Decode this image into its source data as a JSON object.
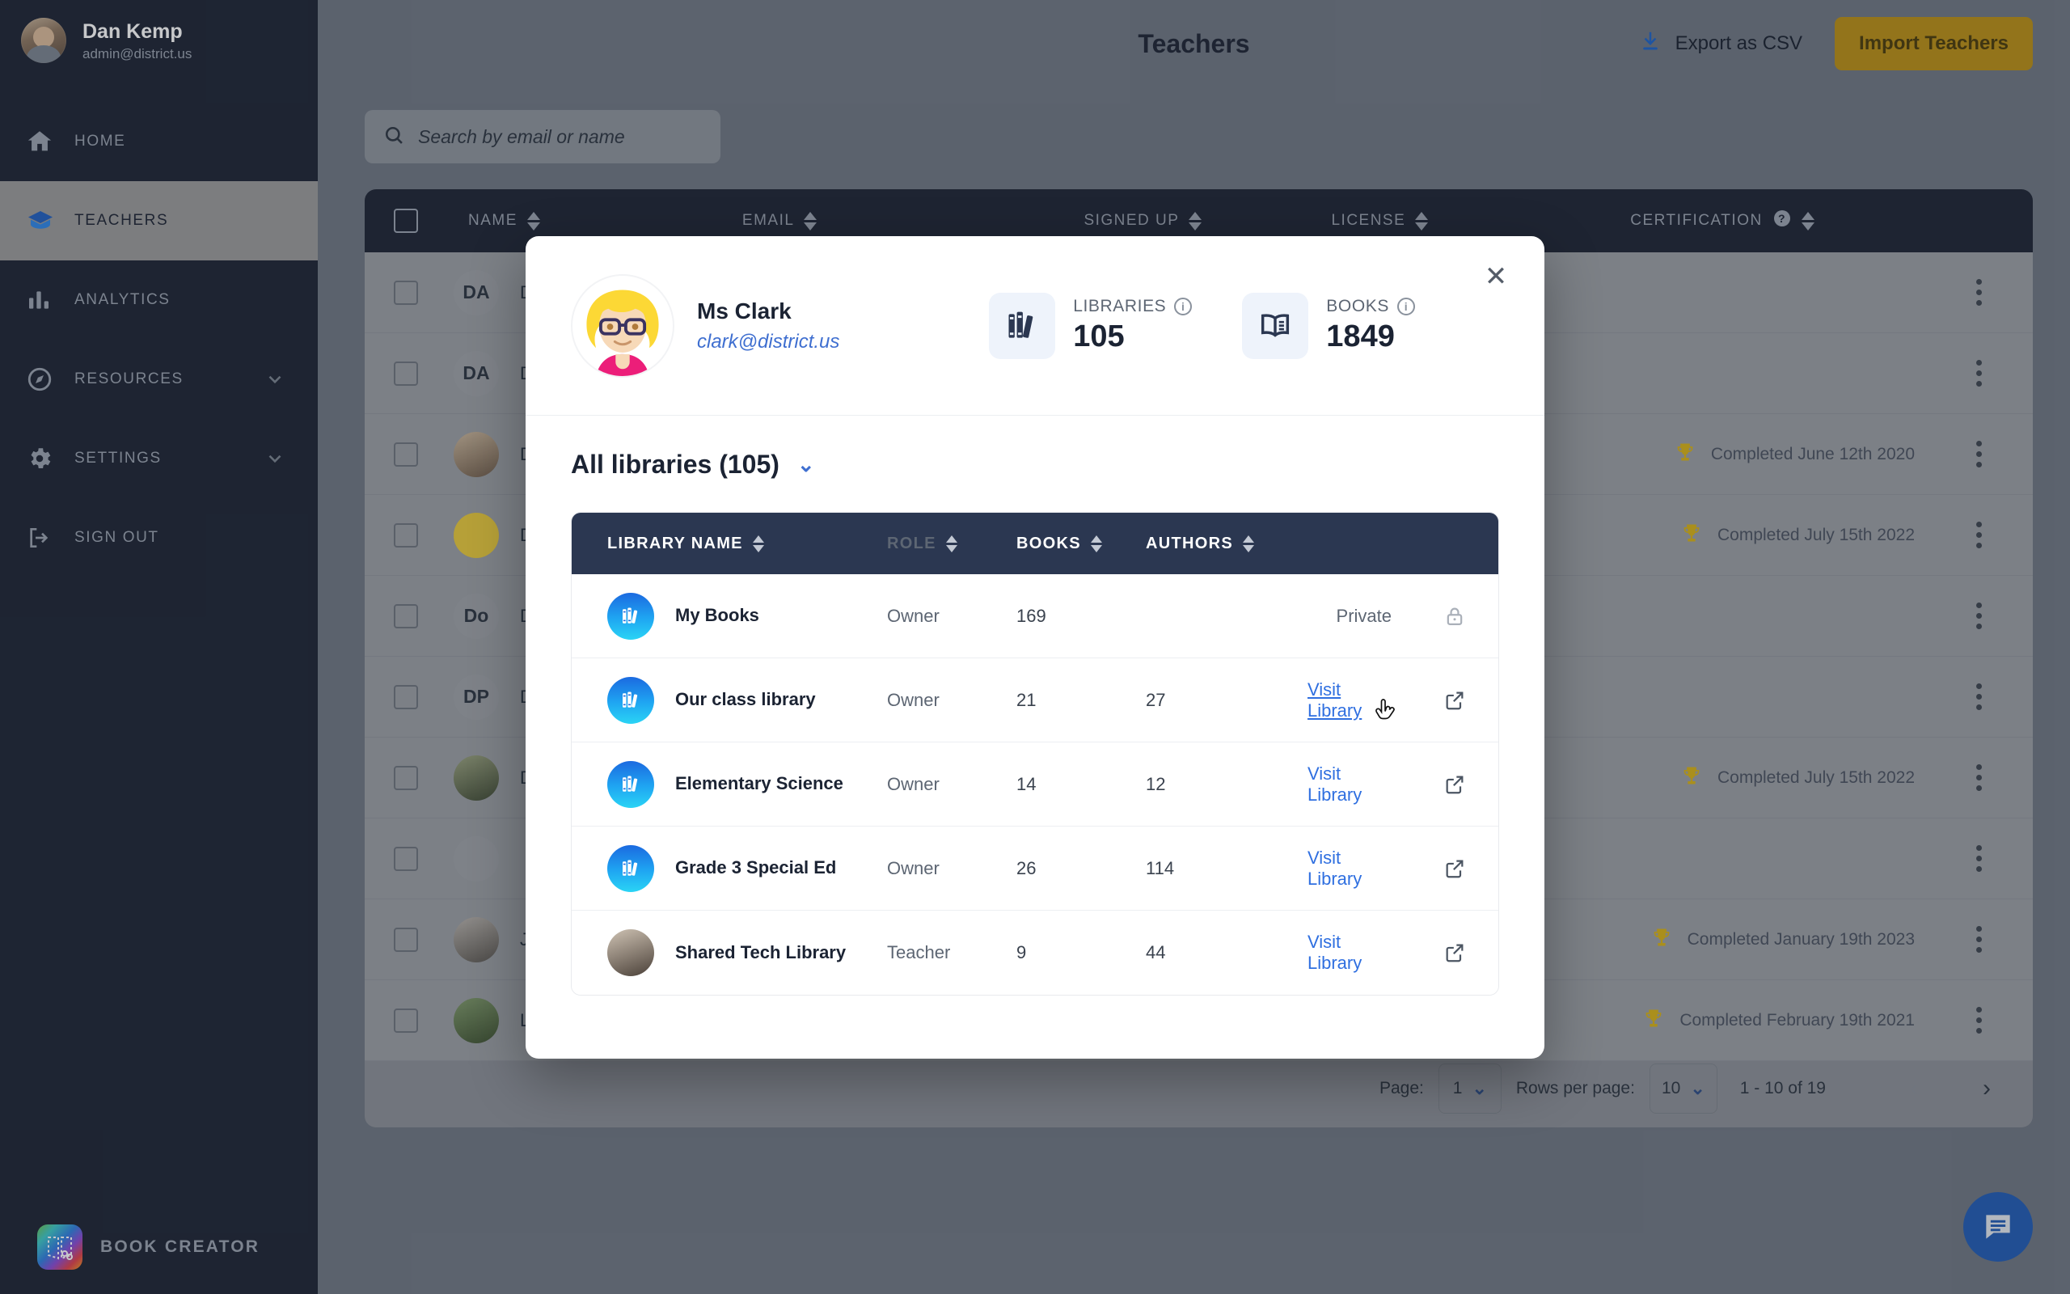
{
  "sidebar": {
    "user": {
      "name": "Dan Kemp",
      "email": "admin@district.us",
      "avatar_icon": "user-photo"
    },
    "items": [
      {
        "label": "HOME",
        "icon": "home-icon",
        "active": false,
        "expandable": false
      },
      {
        "label": "TEACHERS",
        "icon": "graduation-cap-icon",
        "active": true,
        "expandable": false
      },
      {
        "label": "ANALYTICS",
        "icon": "bar-chart-icon",
        "active": false,
        "expandable": false
      },
      {
        "label": "RESOURCES",
        "icon": "compass-icon",
        "active": false,
        "expandable": true
      },
      {
        "label": "SETTINGS",
        "icon": "gear-icon",
        "active": false,
        "expandable": true
      },
      {
        "label": "SIGN OUT",
        "icon": "sign-out-icon",
        "active": false,
        "expandable": false
      }
    ],
    "brand": {
      "label": "BOOK CREATOR",
      "icon": "book-creator-logo"
    }
  },
  "header": {
    "title": "Teachers",
    "export_label": "Export as CSV",
    "export_icon": "download-icon",
    "import_label": "Import Teachers",
    "import_color": "#b98e14"
  },
  "search": {
    "placeholder": "Search by email or name",
    "value": "",
    "icon": "search-icon"
  },
  "teachers_table": {
    "columns": [
      "NAME",
      "EMAIL",
      "SIGNED UP",
      "LICENSE",
      "CERTIFICATION"
    ],
    "certification_help_icon": "question-mark-icon",
    "rows": [
      {
        "initials": "DA",
        "name": "D",
        "avatar_type": "initials",
        "certification": ""
      },
      {
        "initials": "DA",
        "name": "D",
        "avatar_type": "initials",
        "certification": ""
      },
      {
        "initials": "",
        "name": "D",
        "avatar_type": "photo",
        "certification": "Completed June 12th 2020"
      },
      {
        "initials": "",
        "name": "D",
        "avatar_type": "cartoon",
        "certification": "Completed July 15th 2022"
      },
      {
        "initials": "Do",
        "name": "D",
        "avatar_type": "initials",
        "certification": ""
      },
      {
        "initials": "DP",
        "name": "D",
        "avatar_type": "initials",
        "certification": ""
      },
      {
        "initials": "",
        "name": "D",
        "avatar_type": "photo",
        "certification": "Completed July 15th 2022"
      },
      {
        "initials": "",
        "name": "",
        "avatar_type": "empty",
        "certification": ""
      },
      {
        "initials": "",
        "name": "J",
        "avatar_type": "photo",
        "certification": "Completed January 19th 2023"
      },
      {
        "initials": "",
        "name": "L",
        "avatar_type": "photo",
        "certification": "Completed February 19th 2021"
      }
    ],
    "trophy_icon": "trophy-icon",
    "kebab_icon": "more-vertical-icon"
  },
  "pagination": {
    "page_label": "Page:",
    "page_value": "1",
    "rows_label": "Rows per page:",
    "rows_value": "10",
    "range_text": "1 - 10 of 19",
    "prev_icon": "chevron-left-icon",
    "next_icon": "chevron-right-icon"
  },
  "chat_fab": {
    "icon": "chat-bubble-icon",
    "color": "#1f5bb5"
  },
  "modal": {
    "close_icon": "close-icon",
    "teacher": {
      "name": "Ms Clark",
      "email": "clark@district.us",
      "avatar_icon": "cartoon-avatar-blonde-glasses"
    },
    "stats": [
      {
        "label": "LIBRARIES",
        "value": "105",
        "icon": "books-shelf-icon",
        "info_icon": "info-icon"
      },
      {
        "label": "BOOKS",
        "value": "1849",
        "icon": "open-book-icon",
        "info_icon": "info-icon"
      }
    ],
    "libraries_section": {
      "title": "All libraries (105)",
      "chevron_icon": "chevron-down-icon",
      "columns": [
        "LIBRARY NAME",
        "ROLE",
        "BOOKS",
        "AUTHORS"
      ],
      "rows": [
        {
          "name": "My Books",
          "role": "Owner",
          "books": "169",
          "authors": "",
          "action": "Private",
          "action_type": "private",
          "icon": "library-icon",
          "trailing_icon": "lock-icon"
        },
        {
          "name": "Our class library",
          "role": "Owner",
          "books": "21",
          "authors": "27",
          "action": "Visit Library",
          "action_type": "link",
          "icon": "library-icon",
          "trailing_icon": "external-link-icon",
          "hovered": true
        },
        {
          "name": "Elementary Science",
          "role": "Owner",
          "books": "14",
          "authors": "12",
          "action": "Visit Library",
          "action_type": "link",
          "icon": "library-icon",
          "trailing_icon": "external-link-icon"
        },
        {
          "name": "Grade 3 Special Ed",
          "role": "Owner",
          "books": "26",
          "authors": "114",
          "action": "Visit Library",
          "action_type": "link",
          "icon": "library-icon",
          "trailing_icon": "external-link-icon"
        },
        {
          "name": "Shared Tech Library",
          "role": "Teacher",
          "books": "9",
          "authors": "44",
          "action": "Visit Library",
          "action_type": "link",
          "icon": "teacher-photo-icon",
          "trailing_icon": "external-link-icon"
        }
      ]
    }
  }
}
